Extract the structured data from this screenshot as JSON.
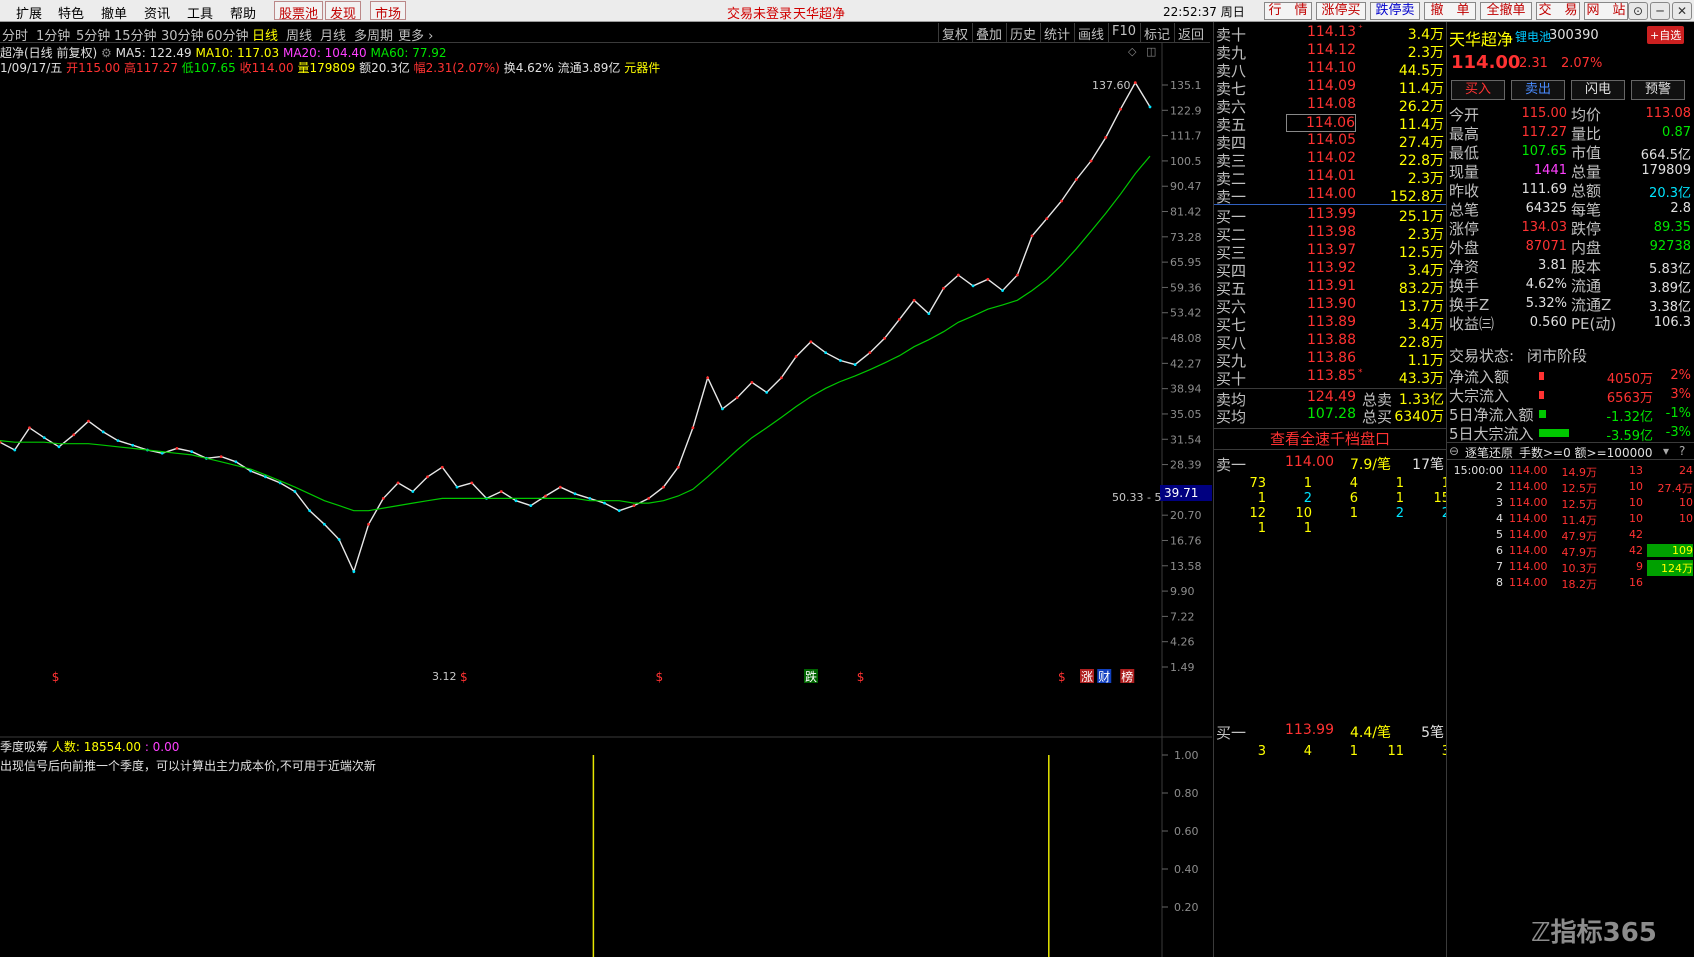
{
  "menu": {
    "items": [
      "扩展",
      "特色",
      "撤单",
      "资讯",
      "工具",
      "帮助"
    ],
    "red_items": [
      "股票池",
      "发现",
      "市场"
    ],
    "notice_login": "交易未登录",
    "notice_title": "天华超净",
    "clock": "22:52:37 周日",
    "right_buttons": [
      "行　情",
      "涨停买",
      "跌停卖",
      "撤　单",
      "全撤单",
      "交　易",
      "网　站"
    ],
    "window_controls": [
      "⊙",
      "─",
      "▢",
      "✕"
    ]
  },
  "periods": {
    "items": [
      "分时",
      "1分钟",
      "5分钟",
      "15分钟",
      "30分钟",
      "60分钟",
      "日线",
      "周线",
      "月线",
      "多周期",
      "更多 ›"
    ],
    "active": "日线",
    "tools": [
      "复权",
      "叠加",
      "历史",
      "统计",
      "画线",
      "F10",
      "标记",
      "返回"
    ]
  },
  "info": {
    "stock_label": "超净(日线 前复权)",
    "ma5": "MA5: 122.49",
    "ma10": "MA10: 117.03",
    "ma20": "MA20: 104.40",
    "ma60": "MA60: 77.92",
    "date": "1/09/17/五",
    "open": "开115.00",
    "high": "高117.27",
    "low": "低107.65",
    "close": "收114.00",
    "volume": "量179809",
    "amount": "额20.3亿",
    "change": "幅2.31(2.07%)",
    "turnover": "换4.62%",
    "float": "流通3.89亿",
    "sector": "元器件"
  },
  "chart_data": {
    "type": "line",
    "title": "天华超净 日线 前复权",
    "y_ticks": [
      "135.1",
      "122.9",
      "111.7",
      "100.5",
      "90.47",
      "81.42",
      "73.28",
      "65.95",
      "59.36",
      "53.42",
      "48.08",
      "42.27",
      "38.94",
      "35.05",
      "31.54",
      "28.39",
      "25.55",
      "20.70",
      "16.76",
      "13.58",
      "9.90",
      "7.22",
      "4.26",
      "1.49"
    ],
    "current_price_tag": "39.71",
    "annotations": {
      "high": "137.60",
      "low": "3.12",
      "mid": "50.33 - 5"
    },
    "markers": [
      {
        "label": "$",
        "pos": 0.045
      },
      {
        "label": "$",
        "pos": 0.4
      },
      {
        "label": "$",
        "pos": 0.57
      },
      {
        "label": "跌",
        "pos": 0.7
      },
      {
        "label": "$",
        "pos": 0.745
      },
      {
        "label": "$",
        "pos": 0.92
      },
      {
        "label": "涨",
        "pos": 0.94
      },
      {
        "label": "财",
        "pos": 0.955
      },
      {
        "label": "榜",
        "pos": 0.975
      }
    ],
    "series": [
      {
        "name": "price",
        "color": "#e8e8e8",
        "values": [
          8.5,
          8.0,
          9.5,
          8.8,
          8.2,
          9.0,
          10.0,
          9.2,
          8.6,
          8.3,
          8.0,
          7.8,
          8.1,
          7.9,
          7.5,
          7.6,
          7.3,
          6.8,
          6.5,
          6.2,
          5.8,
          5.0,
          4.5,
          4.0,
          3.12,
          4.5,
          5.5,
          6.2,
          5.8,
          6.5,
          7.0,
          6.0,
          6.2,
          5.5,
          5.8,
          5.4,
          5.2,
          5.6,
          6.0,
          5.7,
          5.5,
          5.3,
          5.0,
          5.2,
          5.5,
          6.0,
          7.0,
          9.5,
          14.0,
          11.0,
          12.0,
          13.5,
          12.5,
          14.0,
          16.5,
          18.5,
          17.0,
          16.0,
          15.5,
          17.0,
          19.0,
          22.0,
          25.5,
          23.0,
          28.0,
          31.0,
          28.5,
          30.0,
          27.5,
          31.0,
          42.0,
          48.0,
          55.0,
          65.0,
          75.0,
          90.0,
          112.0,
          137.6,
          114.0
        ]
      },
      {
        "name": "MA60",
        "color": "#00c800",
        "values": [
          8.6,
          8.5,
          8.5,
          8.5,
          8.4,
          8.4,
          8.4,
          8.3,
          8.2,
          8.1,
          8.0,
          7.9,
          7.8,
          7.7,
          7.5,
          7.3,
          7.1,
          6.9,
          6.6,
          6.3,
          6.0,
          5.7,
          5.4,
          5.2,
          5.0,
          5.0,
          5.1,
          5.2,
          5.3,
          5.4,
          5.5,
          5.5,
          5.5,
          5.5,
          5.5,
          5.5,
          5.5,
          5.5,
          5.5,
          5.5,
          5.4,
          5.4,
          5.4,
          5.3,
          5.3,
          5.4,
          5.6,
          5.9,
          6.5,
          7.2,
          8.0,
          8.8,
          9.5,
          10.3,
          11.2,
          12.1,
          12.9,
          13.6,
          14.2,
          14.9,
          15.7,
          16.6,
          17.8,
          18.8,
          20.0,
          21.5,
          22.6,
          23.8,
          24.6,
          25.5,
          27.5,
          30.0,
          33.5,
          38.0,
          43.5,
          50.0,
          58.0,
          68.0,
          77.92
        ]
      }
    ],
    "sub_indicator": {
      "name": "季度吸筹",
      "people_label": "人数:",
      "people_value": "18554.00",
      "zero_value": ": 0.00",
      "note": "出现信号后向前推一个季度，可以计算出主力成本价,不可用于近端次新",
      "y_ticks": [
        "1.00",
        "0.80",
        "0.60",
        "0.40",
        "0.20"
      ],
      "bars": [
        {
          "pos": 0.516,
          "value": 0.98
        },
        {
          "pos": 0.912,
          "value": 0.98
        }
      ]
    }
  },
  "orderbook": {
    "asks": [
      {
        "label": "卖十",
        "price": "114.13",
        "mark": "⁺",
        "vol": "3.4万"
      },
      {
        "label": "卖九",
        "price": "114.12",
        "mark": "",
        "vol": "2.3万"
      },
      {
        "label": "卖八",
        "price": "114.10",
        "mark": "",
        "vol": "44.5万"
      },
      {
        "label": "卖七",
        "price": "114.09",
        "mark": "",
        "vol": "11.4万"
      },
      {
        "label": "卖六",
        "price": "114.08",
        "mark": "",
        "vol": "26.2万"
      },
      {
        "label": "卖五",
        "price": "114.06",
        "mark": "",
        "vol": "11.4万"
      },
      {
        "label": "卖四",
        "price": "114.05",
        "mark": "",
        "vol": "27.4万"
      },
      {
        "label": "卖三",
        "price": "114.02",
        "mark": "",
        "vol": "22.8万"
      },
      {
        "label": "卖二",
        "price": "114.01",
        "mark": "",
        "vol": "2.3万"
      },
      {
        "label": "卖一",
        "price": "114.00",
        "mark": "",
        "vol": "152.8万"
      }
    ],
    "bids": [
      {
        "label": "买一",
        "price": "113.99",
        "mark": "",
        "vol": "25.1万"
      },
      {
        "label": "买二",
        "price": "113.98",
        "mark": "",
        "vol": "2.3万"
      },
      {
        "label": "买三",
        "price": "113.97",
        "mark": "",
        "vol": "12.5万"
      },
      {
        "label": "买四",
        "price": "113.92",
        "mark": "",
        "vol": "3.4万"
      },
      {
        "label": "买五",
        "price": "113.91",
        "mark": "",
        "vol": "83.2万"
      },
      {
        "label": "买六",
        "price": "113.90",
        "mark": "",
        "vol": "13.7万"
      },
      {
        "label": "买七",
        "price": "113.89",
        "mark": "",
        "vol": "3.4万"
      },
      {
        "label": "买八",
        "price": "113.88",
        "mark": "",
        "vol": "22.8万"
      },
      {
        "label": "买九",
        "price": "113.86",
        "mark": "",
        "vol": "1.1万"
      },
      {
        "label": "买十",
        "price": "113.85",
        "mark": "*",
        "vol": "43.3万"
      }
    ],
    "ask_avg_label": "卖均",
    "ask_avg": "124.49",
    "ask_total_label": "总卖",
    "ask_total": "1.33亿",
    "bid_avg_label": "买均",
    "bid_avg": "107.28",
    "bid_total_label": "总买",
    "bid_total": "6340万",
    "quick_link": "查看全速千档盘口",
    "sell1_label": "卖一",
    "sell1_price": "114.00",
    "sell1_avg": "7.9/笔",
    "sell1_count": "17笔",
    "sell1_queue": [
      [
        "73",
        "1",
        "4",
        "1",
        "1"
      ],
      [
        "1",
        "2",
        "6",
        "1",
        "15"
      ],
      [
        "12",
        "10",
        "1",
        "2",
        "2"
      ],
      [
        "1",
        "1",
        "",
        "",
        ""
      ]
    ],
    "buy1_label": "买一",
    "buy1_price": "113.99",
    "buy1_avg": "4.4/笔",
    "buy1_count": "5笔",
    "buy1_queue": [
      [
        "3",
        "4",
        "1",
        "11",
        "3"
      ]
    ]
  },
  "quote": {
    "name": "天华超净",
    "sector": "锂电池",
    "code": "300390",
    "add_watch": "+自选",
    "price": "114.00",
    "change": "2.31",
    "change_pct": "2.07%",
    "buttons": [
      "买入",
      "卖出",
      "闪电",
      "预警"
    ],
    "rows": [
      {
        "l1": "今开",
        "v1": "115.00",
        "c1": "up",
        "l2": "均价",
        "v2": "113.08",
        "c2": "up"
      },
      {
        "l1": "最高",
        "v1": "117.27",
        "c1": "up",
        "l2": "量比",
        "v2": "0.87",
        "c2": "dn"
      },
      {
        "l1": "最低",
        "v1": "107.65",
        "c1": "dn",
        "l2": "市值",
        "v2": "664.5亿",
        "c2": "wht"
      },
      {
        "l1": "现量",
        "v1": "1441",
        "c1": "mag",
        "l2": "总量",
        "v2": "179809",
        "c2": "wht"
      },
      {
        "l1": "昨收",
        "v1": "111.69",
        "c1": "wht",
        "l2": "总额",
        "v2": "20.3亿",
        "c2": "cyan"
      },
      {
        "l1": "总笔",
        "v1": "64325",
        "c1": "wht",
        "l2": "每笔",
        "v2": "2.8",
        "c2": "wht"
      },
      {
        "l1": "涨停",
        "v1": "134.03",
        "c1": "up",
        "l2": "跌停",
        "v2": "89.35",
        "c2": "dn"
      },
      {
        "l1": "外盘",
        "v1": "87071",
        "c1": "up",
        "l2": "内盘",
        "v2": "92738",
        "c2": "dn"
      },
      {
        "l1": "净资",
        "v1": "3.81",
        "c1": "wht",
        "l2": "股本",
        "v2": "5.83亿",
        "c2": "wht"
      },
      {
        "l1": "换手",
        "v1": "4.62%",
        "c1": "wht",
        "l2": "流通",
        "v2": "3.89亿",
        "c2": "wht"
      },
      {
        "l1": "换手Z",
        "v1": "5.32%",
        "c1": "wht",
        "l2": "流通Z",
        "v2": "3.38亿",
        "c2": "wht"
      },
      {
        "l1": "收益㈢",
        "v1": "0.560",
        "c1": "wht",
        "l2": "PE(动)",
        "v2": "106.3",
        "c2": "wht"
      }
    ],
    "status_label": "交易状态:",
    "status_value": "闭市阶段",
    "flows": [
      {
        "label": "净流入额",
        "value": "4050万",
        "pct": "2%",
        "cls": "up",
        "bar": "#ff3232",
        "barw": 0.08
      },
      {
        "label": "大宗流入",
        "value": "6563万",
        "pct": "3%",
        "cls": "up",
        "bar": "#ff3232",
        "barw": 0.08
      },
      {
        "label": "5日净流入额",
        "value": "-1.32亿",
        "pct": "-1%",
        "cls": "dn",
        "bar": "#00c800",
        "barw": 0.12
      },
      {
        "label": "5日大宗流入",
        "value": "-3.59亿",
        "pct": "-3%",
        "cls": "dn",
        "bar": "#00c800",
        "barw": 0.5
      }
    ],
    "ticks_header": "逐笔还原",
    "ticks_filter": "手数>=0 额>=100000",
    "ticks": [
      {
        "idx": "15:00:00",
        "price": "114.00",
        "amt": "14.9万",
        "n": "13",
        "extra": "24"
      },
      {
        "idx": "2",
        "price": "114.00",
        "amt": "12.5万",
        "n": "10",
        "extra": "27.4万"
      },
      {
        "idx": "3",
        "price": "114.00",
        "amt": "12.5万",
        "n": "10",
        "extra": "10"
      },
      {
        "idx": "4",
        "price": "114.00",
        "amt": "11.4万",
        "n": "10",
        "extra": "10"
      },
      {
        "idx": "5",
        "price": "114.00",
        "amt": "47.9万",
        "n": "42",
        "extra": ""
      },
      {
        "idx": "6",
        "price": "114.00",
        "amt": "47.9万",
        "n": "42",
        "extra": "109"
      },
      {
        "idx": "7",
        "price": "114.00",
        "amt": "10.3万",
        "n": "9",
        "extra": "124万"
      },
      {
        "idx": "8",
        "price": "114.00",
        "amt": "18.2万",
        "n": "16",
        "extra": ""
      }
    ],
    "watermark": "指标365"
  }
}
